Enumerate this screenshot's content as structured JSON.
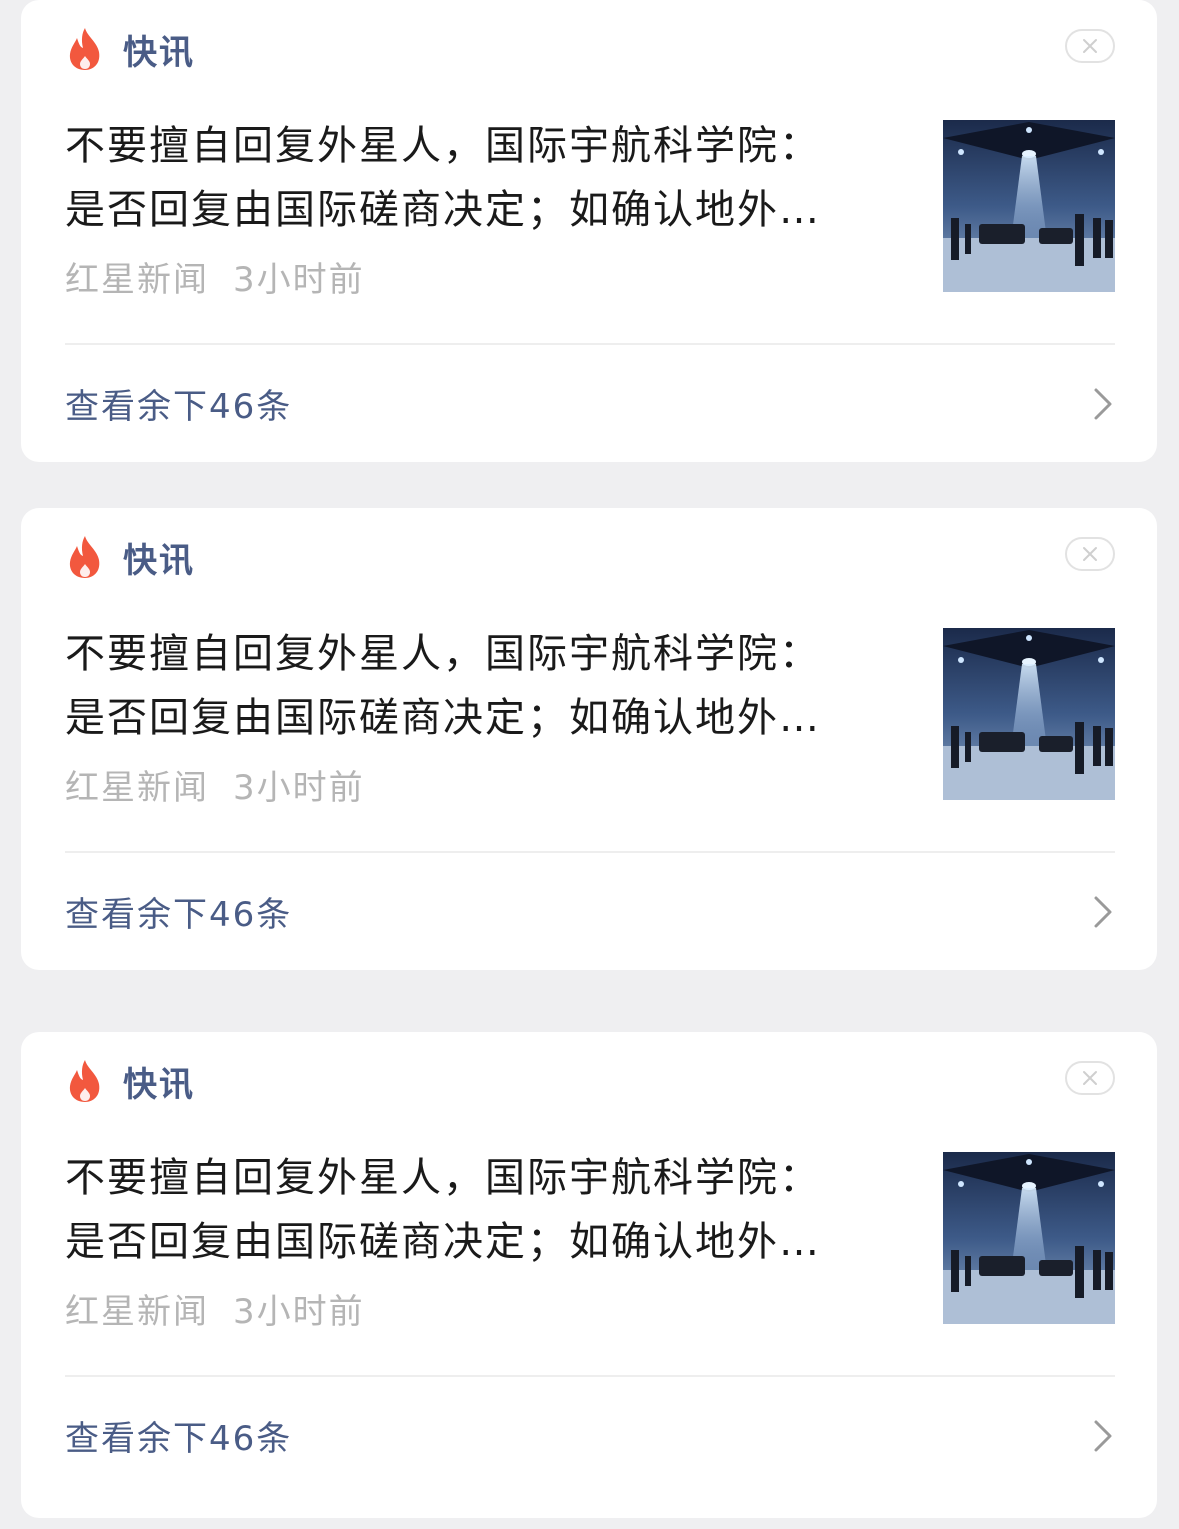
{
  "cards": [
    {
      "section_label": "快讯",
      "headline_line1": "不要擅自回复外星人，国际宇航科学院：",
      "headline_line2": "是否回复由国际磋商决定；如确认地外…",
      "source": "红星新闻",
      "time": "3小时前",
      "more_label": "查看余下46条"
    },
    {
      "section_label": "快讯",
      "headline_line1": "不要擅自回复外星人，国际宇航科学院：",
      "headline_line2": "是否回复由国际磋商决定；如确认地外…",
      "source": "红星新闻",
      "time": "3小时前",
      "more_label": "查看余下46条"
    },
    {
      "section_label": "快讯",
      "headline_line1": "不要擅自回复外星人，国际宇航科学院：",
      "headline_line2": "是否回复由国际磋商决定；如确认地外…",
      "source": "红星新闻",
      "time": "3小时前",
      "more_label": "查看余下46条"
    }
  ],
  "icons": {
    "section": "fire-icon",
    "close": "close-icon",
    "more": "chevron-right-icon"
  },
  "colors": {
    "accent": "#4a5c86",
    "fire": "#f2583e",
    "meta": "#b5b5b5",
    "background": "#efeff1"
  }
}
